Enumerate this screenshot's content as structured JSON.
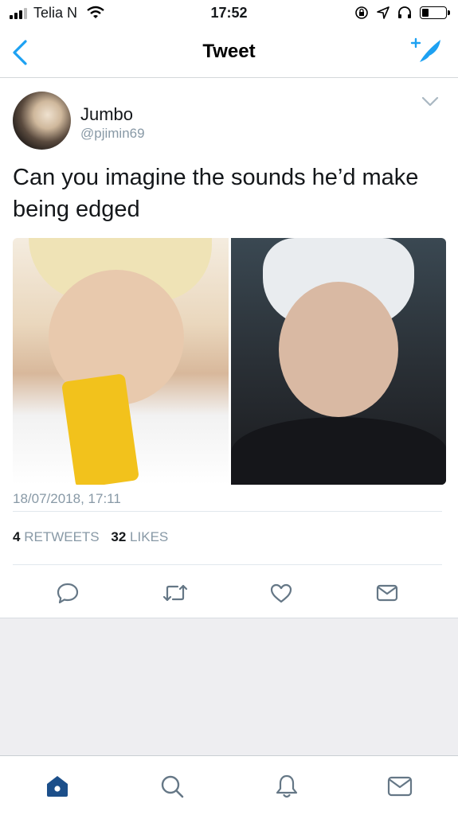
{
  "status_bar": {
    "carrier": "Telia N",
    "time": "17:52",
    "battery_level": 0.3
  },
  "nav": {
    "title": "Tweet",
    "back_icon": "chevron-left-icon",
    "compose_icon": "compose-tweet-icon"
  },
  "tweet": {
    "display_name": "Jumbo",
    "handle": "@pjimin69",
    "text": "Can you imagine the sounds he’d make being edged",
    "timestamp": "18/07/2018, 17:11",
    "retweets_count": "4",
    "retweets_label": "RETWEETS",
    "likes_count": "32",
    "likes_label": "LIKES",
    "media_count": 2
  },
  "actions": [
    {
      "name": "reply",
      "icon": "reply-icon"
    },
    {
      "name": "retweet",
      "icon": "retweet-icon"
    },
    {
      "name": "like",
      "icon": "heart-icon"
    },
    {
      "name": "share",
      "icon": "mail-icon"
    }
  ],
  "tab_bar": [
    {
      "name": "home",
      "icon": "home-icon",
      "active": true
    },
    {
      "name": "search",
      "icon": "search-icon",
      "active": false
    },
    {
      "name": "notifications",
      "icon": "bell-icon",
      "active": false
    },
    {
      "name": "messages",
      "icon": "mail-icon",
      "active": false
    }
  ],
  "colors": {
    "accent": "#1da1f2",
    "text_primary": "#14171a",
    "text_secondary": "#8899a6",
    "tab_active": "#1c4f8a"
  }
}
